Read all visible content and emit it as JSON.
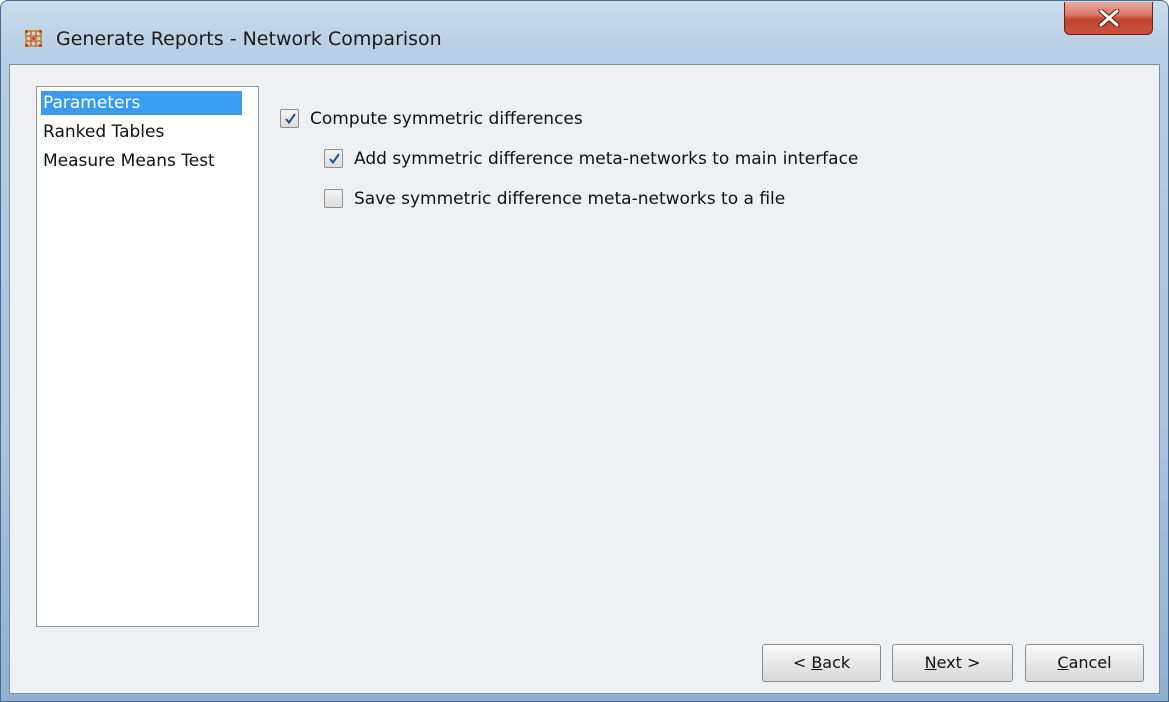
{
  "window": {
    "title": "Generate Reports - Network Comparison",
    "icon": "meta-network-grid-icon",
    "close_icon": "close-x-icon",
    "accent_close": "#c7513d"
  },
  "sidebar": {
    "items": [
      {
        "label": "Parameters",
        "selected": true
      },
      {
        "label": "Ranked Tables",
        "selected": false
      },
      {
        "label": "Measure Means Test",
        "selected": false
      }
    ],
    "selection_color": "#3a9cf1"
  },
  "options": {
    "compute": {
      "label": "Compute symmetric differences",
      "checked": true
    },
    "add_to_main": {
      "label": "Add symmetric difference meta-networks to main interface",
      "checked": true
    },
    "save_to_file": {
      "label": "Save symmetric difference meta-networks to a file",
      "checked": false
    }
  },
  "buttons": {
    "back": {
      "prefix": "< ",
      "mnemonic": "B",
      "rest": "ack"
    },
    "next": {
      "mnemonic": "N",
      "rest": "ext >"
    },
    "cancel": {
      "mnemonic": "C",
      "rest": "ancel"
    }
  }
}
